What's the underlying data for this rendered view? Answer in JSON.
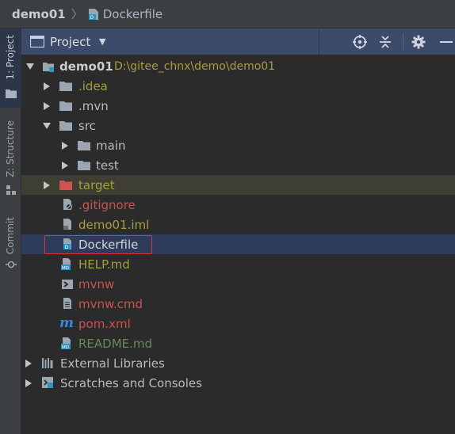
{
  "breadcrumb": {
    "project": "demo01",
    "separator": "〉",
    "file": "Dockerfile"
  },
  "side_tabs": [
    {
      "label": "1: Project",
      "active": true
    },
    {
      "label": "Z: Structure",
      "active": false
    },
    {
      "label": "Commit",
      "active": false
    }
  ],
  "panel": {
    "title": "Project",
    "icons": [
      "locate-icon",
      "collapse-all-icon",
      "gear-icon",
      "hide-icon"
    ]
  },
  "tree": {
    "root": {
      "name": "demo01",
      "path": "D:\\gitee_chnx\\demo\\demo01"
    },
    "items": [
      {
        "name": ".idea",
        "kind": "folder",
        "color": "#a3a03a"
      },
      {
        "name": ".mvn",
        "kind": "folder",
        "color": "#bbbbbb"
      },
      {
        "name": "src",
        "kind": "folder",
        "color": "#bbbbbb"
      },
      {
        "name": "main",
        "kind": "folder",
        "color": "#bbbbbb"
      },
      {
        "name": "test",
        "kind": "folder",
        "color": "#bbbbbb"
      },
      {
        "name": "target",
        "kind": "folder",
        "color": "#c75450"
      },
      {
        "name": ".gitignore",
        "kind": "file",
        "color": "#c75450"
      },
      {
        "name": "demo01.iml",
        "kind": "file",
        "color": "#a3a03a"
      },
      {
        "name": "Dockerfile",
        "kind": "file",
        "color": "#d0d0d0"
      },
      {
        "name": "HELP.md",
        "kind": "file",
        "color": "#a3a03a"
      },
      {
        "name": "mvnw",
        "kind": "file",
        "color": "#c75450"
      },
      {
        "name": "mvnw.cmd",
        "kind": "file",
        "color": "#c75450"
      },
      {
        "name": "pom.xml",
        "kind": "file",
        "color": "#c75450"
      },
      {
        "name": "README.md",
        "kind": "file",
        "color": "#6a8759"
      }
    ],
    "external_libraries": "External Libraries",
    "scratches": "Scratches and Consoles"
  },
  "colors": {
    "selection": "#2f3b5b",
    "excluded_row": "#3e3e33",
    "header": "#3d4b6a",
    "highlight_border": "#d43b3b"
  }
}
